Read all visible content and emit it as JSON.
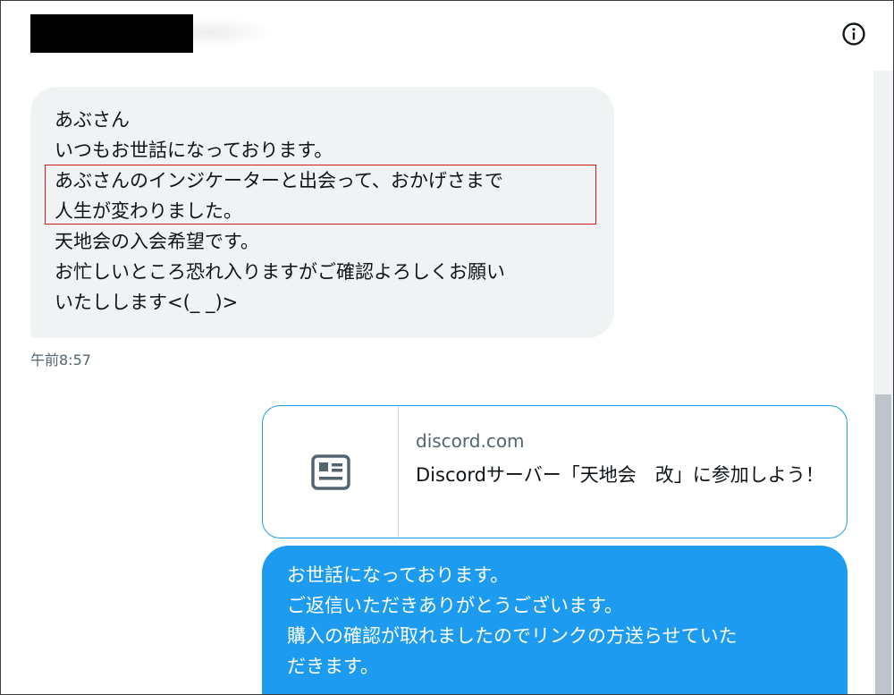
{
  "header": {
    "info_icon": "info-circle-icon"
  },
  "messages": {
    "incoming": {
      "lines": [
        "あぶさん",
        "いつもお世話になっております。",
        "あぶさんのインジケーターと出会って、おかげさまで",
        "人生が変わりました。",
        "天地会の入会希望です。",
        "お忙しいところ恐れ入りますがご確認よろしくお願い",
        "いたしします<(_ _)>"
      ],
      "timestamp": "午前8:57"
    },
    "link_card": {
      "icon": "article-icon",
      "domain": "discord.com",
      "title": "Discordサーバー「天地会　改」に参加しよう！"
    },
    "outgoing": {
      "lines": [
        "お世話になっております。",
        "ご返信いただきありがとうございます。",
        "購入の確認が取れましたのでリンクの方送らせていた",
        "だきます。"
      ]
    }
  },
  "colors": {
    "incoming_bubble": "#eff3f4",
    "outgoing_bubble": "#1d9bf0",
    "highlight_border": "#d21a1a",
    "muted_text": "#536471"
  }
}
